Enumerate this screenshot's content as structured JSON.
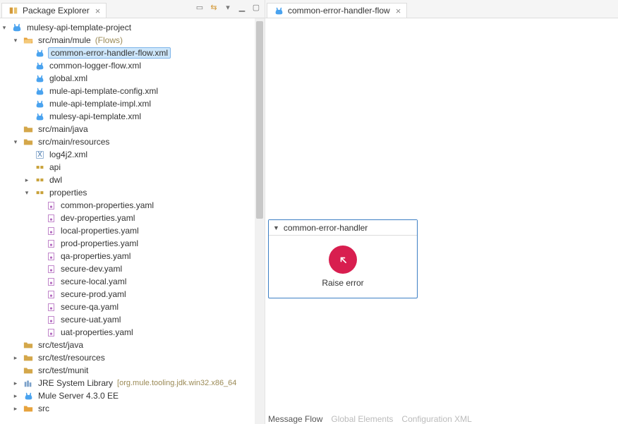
{
  "leftTab": {
    "title": "Package Explorer"
  },
  "rightTab": {
    "title": "common-error-handler-flow"
  },
  "flowBox": {
    "title": "common-error-handler",
    "nodeLabel": "Raise error"
  },
  "bottomTabs": [
    "Message Flow",
    "Global Elements",
    "Configuration XML"
  ],
  "tree": {
    "project": "mulesy-api-template-project",
    "muleFolder": {
      "label": "src/main/mule",
      "annot": "(Flows)"
    },
    "muleFiles": [
      "common-error-handler-flow.xml",
      "common-logger-flow.xml",
      "global.xml",
      "mule-api-template-config.xml",
      "mule-api-template-impl.xml",
      "mulesy-api-template.xml"
    ],
    "javaFolder": "src/main/java",
    "resourcesFolder": "src/main/resources",
    "resourceItems": {
      "log4j2": "log4j2.xml",
      "api": "api",
      "dwl": "dwl",
      "props": "properties"
    },
    "propertyFiles": [
      "common-properties.yaml",
      "dev-properties.yaml",
      "local-properties.yaml",
      "prod-properties.yaml",
      "qa-properties.yaml",
      "secure-dev.yaml",
      "secure-local.yaml",
      "secure-prod.yaml",
      "secure-qa.yaml",
      "secure-uat.yaml",
      "uat-properties.yaml"
    ],
    "testJava": "src/test/java",
    "testResources": "src/test/resources",
    "testMunit": "src/test/munit",
    "jre": {
      "label": "JRE System Library",
      "annot": "[org.mule.tooling.jdk.win32.x86_64"
    },
    "muleServer": "Mule Server 4.3.0 EE",
    "src": "src"
  }
}
